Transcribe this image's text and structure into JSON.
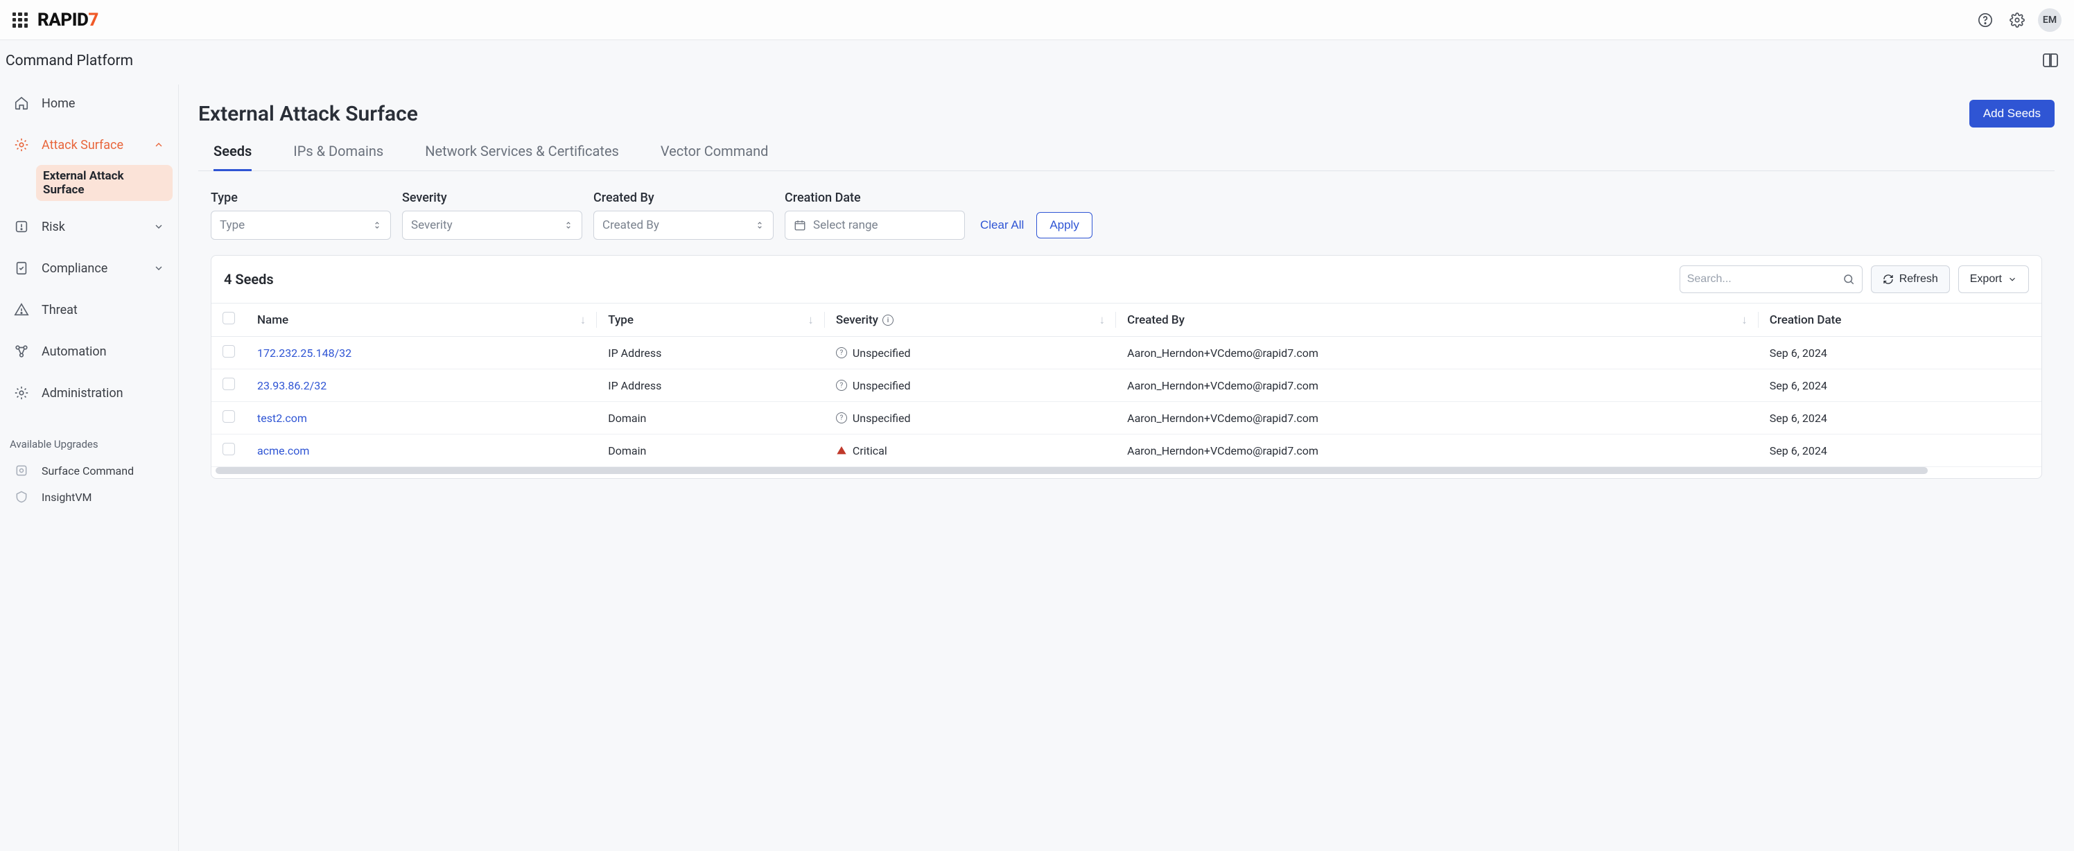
{
  "topbar": {
    "help_tooltip": "Help",
    "settings_tooltip": "Settings",
    "avatar_initials": "EM"
  },
  "logo": {
    "part1": "RAPID",
    "part2": "7"
  },
  "breadcrumb": "Command Platform",
  "sidebar": {
    "items": [
      {
        "id": "home",
        "label": "Home"
      },
      {
        "id": "attack-surface",
        "label": "Attack Surface",
        "active": true,
        "expanded": true,
        "children": [
          {
            "id": "external-attack-surface",
            "label": "External Attack Surface",
            "selected": true
          }
        ]
      },
      {
        "id": "risk",
        "label": "Risk"
      },
      {
        "id": "compliance",
        "label": "Compliance"
      },
      {
        "id": "threat",
        "label": "Threat"
      },
      {
        "id": "automation",
        "label": "Automation"
      },
      {
        "id": "administration",
        "label": "Administration"
      }
    ],
    "upgrades_label": "Available Upgrades",
    "upgrades": [
      {
        "id": "surface-command",
        "label": "Surface Command"
      },
      {
        "id": "insightvm",
        "label": "InsightVM"
      }
    ]
  },
  "page": {
    "title": "External Attack Surface",
    "add_button": "Add Seeds"
  },
  "tabs": [
    {
      "id": "seeds",
      "label": "Seeds",
      "active": true
    },
    {
      "id": "ips-domains",
      "label": "IPs & Domains"
    },
    {
      "id": "net-svc-cert",
      "label": "Network Services & Certificates"
    },
    {
      "id": "vector-command",
      "label": "Vector Command"
    }
  ],
  "filters": {
    "type": {
      "label": "Type",
      "placeholder": "Type"
    },
    "severity": {
      "label": "Severity",
      "placeholder": "Severity"
    },
    "created_by": {
      "label": "Created By",
      "placeholder": "Created By"
    },
    "creation_date": {
      "label": "Creation Date",
      "placeholder": "Select range"
    },
    "clear_all": "Clear All",
    "apply": "Apply"
  },
  "table": {
    "title": "4 Seeds",
    "search_placeholder": "Search...",
    "refresh": "Refresh",
    "export": "Export",
    "columns": {
      "name": "Name",
      "type": "Type",
      "severity": "Severity",
      "created_by": "Created By",
      "creation_date": "Creation Date"
    },
    "rows": [
      {
        "name": "172.232.25.148/32",
        "type": "IP Address",
        "severity": "Unspecified",
        "severity_kind": "unspecified",
        "created_by": "Aaron_Herndon+VCdemo@rapid7.com",
        "creation_date": "Sep 6, 2024"
      },
      {
        "name": "23.93.86.2/32",
        "type": "IP Address",
        "severity": "Unspecified",
        "severity_kind": "unspecified",
        "created_by": "Aaron_Herndon+VCdemo@rapid7.com",
        "creation_date": "Sep 6, 2024"
      },
      {
        "name": "test2.com",
        "type": "Domain",
        "severity": "Unspecified",
        "severity_kind": "unspecified",
        "created_by": "Aaron_Herndon+VCdemo@rapid7.com",
        "creation_date": "Sep 6, 2024"
      },
      {
        "name": "acme.com",
        "type": "Domain",
        "severity": "Critical",
        "severity_kind": "critical",
        "created_by": "Aaron_Herndon+VCdemo@rapid7.com",
        "creation_date": "Sep 6, 2024"
      }
    ]
  }
}
